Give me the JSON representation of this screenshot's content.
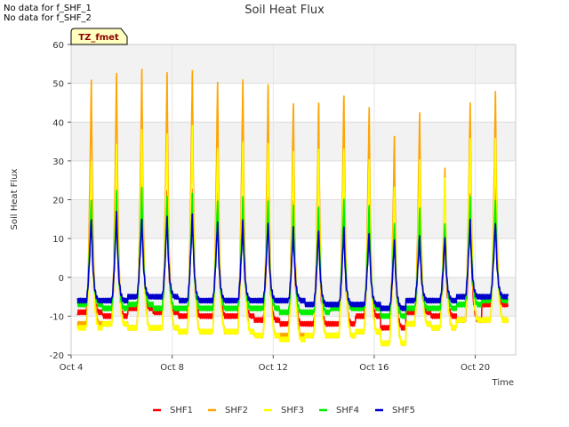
{
  "notes": [
    "No data for f_SHF_1",
    "No data for f_SHF_2"
  ],
  "chart_data": {
    "type": "line",
    "title": "Soil Heat Flux",
    "xlabel": "Time",
    "ylabel": "Soil Heat Flux",
    "tz_label": "TZ_fmet",
    "ylim": [
      -20,
      60
    ],
    "xlim": [
      4,
      21.6
    ],
    "xticks": [
      {
        "value": 4,
        "label": "Oct 4"
      },
      {
        "value": 8,
        "label": "Oct 8"
      },
      {
        "value": 12,
        "label": "Oct 12"
      },
      {
        "value": 16,
        "label": "Oct 16"
      },
      {
        "value": 20,
        "label": "Oct 20"
      }
    ],
    "yticks": [
      -20,
      -10,
      0,
      10,
      20,
      30,
      40,
      50,
      60
    ],
    "grid": true,
    "legend_position": "bottom",
    "peak_days": [
      4.8,
      5.8,
      6.8,
      7.8,
      8.8,
      9.8,
      10.8,
      11.8,
      12.8,
      13.8,
      14.8,
      15.8,
      16.8,
      17.8,
      18.8,
      19.8,
      20.8
    ],
    "series": [
      {
        "name": "SHF1",
        "color": "#ff0000",
        "peaks": [
          22,
          25,
          25,
          23,
          24,
          23,
          21,
          21,
          21,
          19,
          20,
          19,
          16,
          17,
          13,
          23,
          24
        ],
        "troughs": [
          -9,
          -10,
          -8,
          -9,
          -10,
          -10,
          -10,
          -11,
          -12,
          -12,
          -12,
          -10,
          -13,
          -9,
          -10,
          -11,
          -7
        ]
      },
      {
        "name": "SHF2",
        "color": "#ffa500",
        "peaks": [
          52,
          55,
          55,
          55,
          55,
          52,
          53,
          51,
          47,
          46,
          49,
          45,
          38,
          44,
          29,
          47,
          49
        ],
        "troughs": [
          -12,
          -12,
          -13,
          -13,
          -14,
          -14,
          -14,
          -15,
          -15,
          -15,
          -15,
          -14,
          -17,
          -12,
          -13,
          -11,
          -11
        ]
      },
      {
        "name": "SHF3",
        "color": "#ffff00",
        "peaks": [
          31,
          36,
          39,
          39,
          40,
          35,
          36,
          36,
          34,
          34,
          35,
          31,
          25,
          31,
          27,
          37,
          37
        ],
        "troughs": [
          -13,
          -12,
          -13,
          -13,
          -14,
          -14,
          -14,
          -15,
          -16,
          -15,
          -15,
          -14,
          -17,
          -12,
          -13,
          -11,
          -11
        ]
      },
      {
        "name": "SHF4",
        "color": "#00ee00",
        "peaks": [
          21,
          23,
          24,
          22,
          22,
          21,
          21,
          21,
          19,
          19,
          21,
          19,
          15,
          18,
          15,
          21,
          21
        ],
        "troughs": [
          -7,
          -8,
          -7,
          -8,
          -8,
          -8,
          -8,
          -8,
          -9,
          -9,
          -8,
          -8,
          -10,
          -8,
          -8,
          -7,
          -6
        ]
      },
      {
        "name": "SHF5",
        "color": "#0000cc",
        "peaks": [
          16,
          17,
          16,
          16,
          17,
          15,
          15,
          15,
          13,
          13,
          13,
          12,
          10,
          11,
          11,
          15,
          15
        ],
        "troughs": [
          -6,
          -6,
          -5,
          -5,
          -6,
          -6,
          -6,
          -6,
          -6,
          -7,
          -7,
          -7,
          -8,
          -6,
          -6,
          -5,
          -5
        ]
      }
    ]
  }
}
